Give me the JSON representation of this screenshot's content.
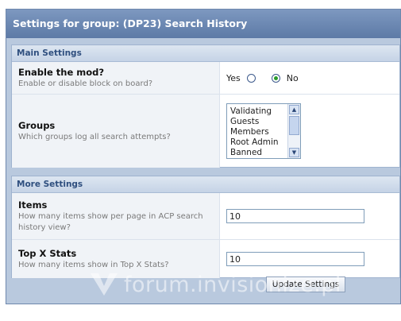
{
  "title": "Settings for group: (DP23) Search History",
  "main_settings": {
    "header": "Main Settings",
    "enable": {
      "label": "Enable the mod?",
      "desc": "Enable or disable block on board?",
      "yes": "Yes",
      "no": "No",
      "selected": "No"
    },
    "groups": {
      "label": "Groups",
      "desc": "Which groups log all search attempts?",
      "options": [
        "Validating",
        "Guests",
        "Members",
        "Root Admin",
        "Banned"
      ]
    }
  },
  "more_settings": {
    "header": "More Settings",
    "items": {
      "label": "Items",
      "desc": "How many items show per page in ACP search history view?",
      "value": "10"
    },
    "topx": {
      "label": "Top X Stats",
      "desc": "How many items show in Top X Stats?",
      "value": "10"
    }
  },
  "update_button": "Update Settings",
  "watermark": "forum.invisionize.pl"
}
